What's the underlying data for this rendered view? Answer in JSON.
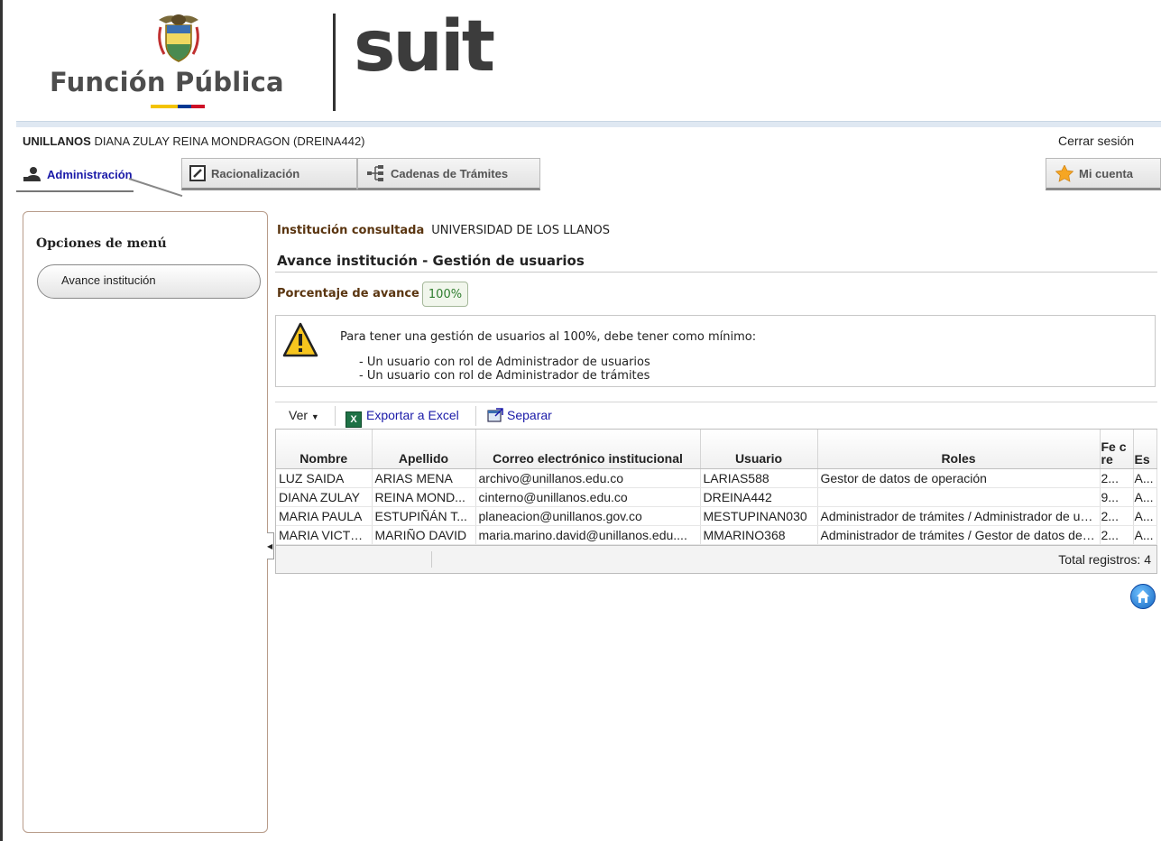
{
  "header": {
    "brand_left": "Función Pública",
    "brand_right": "suit",
    "flag_colors": [
      "#f3c300",
      "#003893",
      "#ce1126"
    ]
  },
  "session": {
    "org": "UNILLANOS",
    "user": "DIANA ZULAY REINA MONDRAGON (DREINA442)",
    "logout_label": "Cerrar sesión"
  },
  "tabs": {
    "admin": "Administración",
    "rac": "Racionalización",
    "cad": "Cadenas de Trámites",
    "cuenta": "Mi cuenta"
  },
  "sidebar": {
    "title": "Opciones de menú",
    "items": [
      {
        "label": "Avance institución",
        "icon": "none"
      }
    ]
  },
  "main": {
    "inst_label": "Institución consultada",
    "inst_value": "UNIVERSIDAD DE LOS LLANOS",
    "title": "Avance institución - Gestión de usuarios",
    "pct_label": "Porcentaje de avance",
    "pct_value": "100%",
    "notice": {
      "line1": "Para tener una gestión de usuarios al 100%, debe tener como mínimo:",
      "items": [
        "- Un usuario con rol de Administrador de usuarios",
        "- Un usuario con rol de Administrador de trámites"
      ]
    }
  },
  "toolbar": {
    "ver": "Ver",
    "excel": "Exportar a Excel",
    "separar": "Separar"
  },
  "grid": {
    "columns": [
      "Nombre",
      "Apellido",
      "Correo electrónico institucional",
      "Usuario",
      "Roles",
      "Fe cre",
      "Es"
    ],
    "rows": [
      [
        "LUZ SAIDA",
        "ARIAS MENA",
        "archivo@unillanos.edu.co",
        "LARIAS588",
        "Gestor de datos de operación",
        "2...",
        "A..."
      ],
      [
        "DIANA ZULAY",
        "REINA MOND...",
        "cinterno@unillanos.edu.co",
        "DREINA442",
        "",
        "9...",
        "A..."
      ],
      [
        "MARIA PAULA",
        "ESTUPIÑÁN T...",
        "planeacion@unillanos.gov.co",
        "MESTUPINAN030",
        "Administrador de trámites / Administrador de usu...",
        "2...",
        "A..."
      ],
      [
        "MARIA VICTO...",
        "MARIÑO DAVID",
        "maria.marino.david@unillanos.edu....",
        "MMARINO368",
        "Administrador de trámites / Gestor de datos de o...",
        "2...",
        "A..."
      ]
    ],
    "total": "Total registros: 4"
  }
}
